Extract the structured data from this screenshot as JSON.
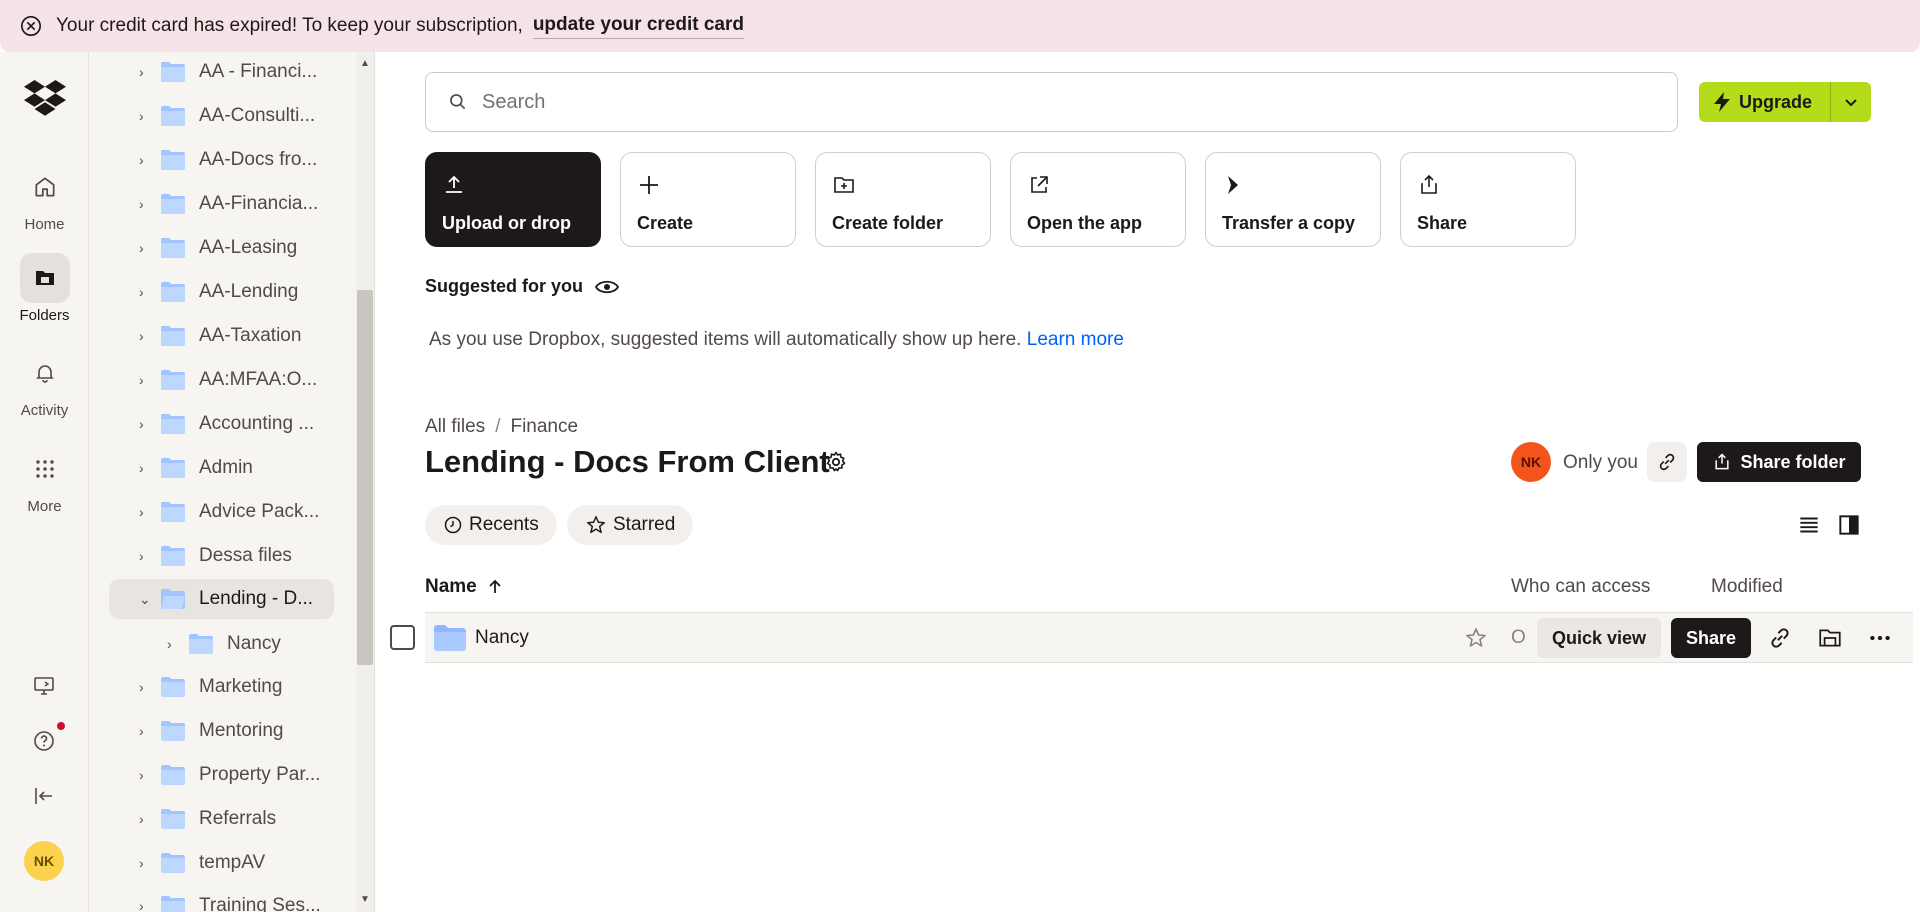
{
  "banner": {
    "message": "Your credit card has expired! To keep your subscription,",
    "link": "update your credit card"
  },
  "rail": {
    "items": [
      {
        "label": "Home",
        "icon": "home-icon"
      },
      {
        "label": "Folders",
        "icon": "folders-icon",
        "active": true
      },
      {
        "label": "Activity",
        "icon": "bell-icon"
      },
      {
        "label": "More",
        "icon": "grid-icon"
      }
    ],
    "avatar": "NK"
  },
  "tree": {
    "items": [
      {
        "label": "AA - Financi..."
      },
      {
        "label": "AA-Consulti..."
      },
      {
        "label": "AA-Docs fro..."
      },
      {
        "label": "AA-Financia..."
      },
      {
        "label": "AA-Leasing"
      },
      {
        "label": "AA-Lending"
      },
      {
        "label": "AA-Taxation"
      },
      {
        "label": "AA:MFAA:O..."
      },
      {
        "label": "Accounting ..."
      },
      {
        "label": "Admin"
      },
      {
        "label": "Advice Pack..."
      },
      {
        "label": "Dessa files"
      },
      {
        "label": "Lending - D...",
        "selected": true,
        "expanded": true
      },
      {
        "label": "Nancy",
        "child": true
      },
      {
        "label": "Marketing"
      },
      {
        "label": "Mentoring"
      },
      {
        "label": "Property Par..."
      },
      {
        "label": "Referrals"
      },
      {
        "label": "tempAV"
      },
      {
        "label": "Training Ses..."
      }
    ]
  },
  "search": {
    "placeholder": "Search"
  },
  "upgrade": {
    "label": "Upgrade"
  },
  "actions": [
    {
      "label": "Upload or drop",
      "icon": "upload-icon"
    },
    {
      "label": "Create",
      "icon": "plus-icon"
    },
    {
      "label": "Create folder",
      "icon": "folder-plus-icon"
    },
    {
      "label": "Open the app",
      "icon": "external-link-icon"
    },
    {
      "label": "Transfer a copy",
      "icon": "transfer-icon"
    },
    {
      "label": "Share",
      "icon": "share-icon"
    }
  ],
  "suggested": {
    "title": "Suggested for you",
    "text": "As you use Dropbox, suggested items will automatically show up here.",
    "learn_more": "Learn more"
  },
  "breadcrumb": {
    "root": "All files",
    "sep": "/",
    "current": "Finance"
  },
  "folder": {
    "title": "Lending - Docs From Client",
    "owner_badge": "NK",
    "access": "Only you",
    "share_folder": "Share folder"
  },
  "chips": {
    "recents": "Recents",
    "starred": "Starred"
  },
  "table": {
    "headers": {
      "name": "Name",
      "access": "Who can access",
      "modified": "Modified"
    },
    "rows": [
      {
        "name": "Nancy",
        "access_partial": "O",
        "quick_view": "Quick view",
        "share": "Share"
      }
    ]
  },
  "colors": {
    "accent": "#b4dc19",
    "banner_bg": "#f6e3e7",
    "link": "#0061fe",
    "avatar_orange": "#f2541b",
    "avatar_yellow": "#fad24b"
  }
}
